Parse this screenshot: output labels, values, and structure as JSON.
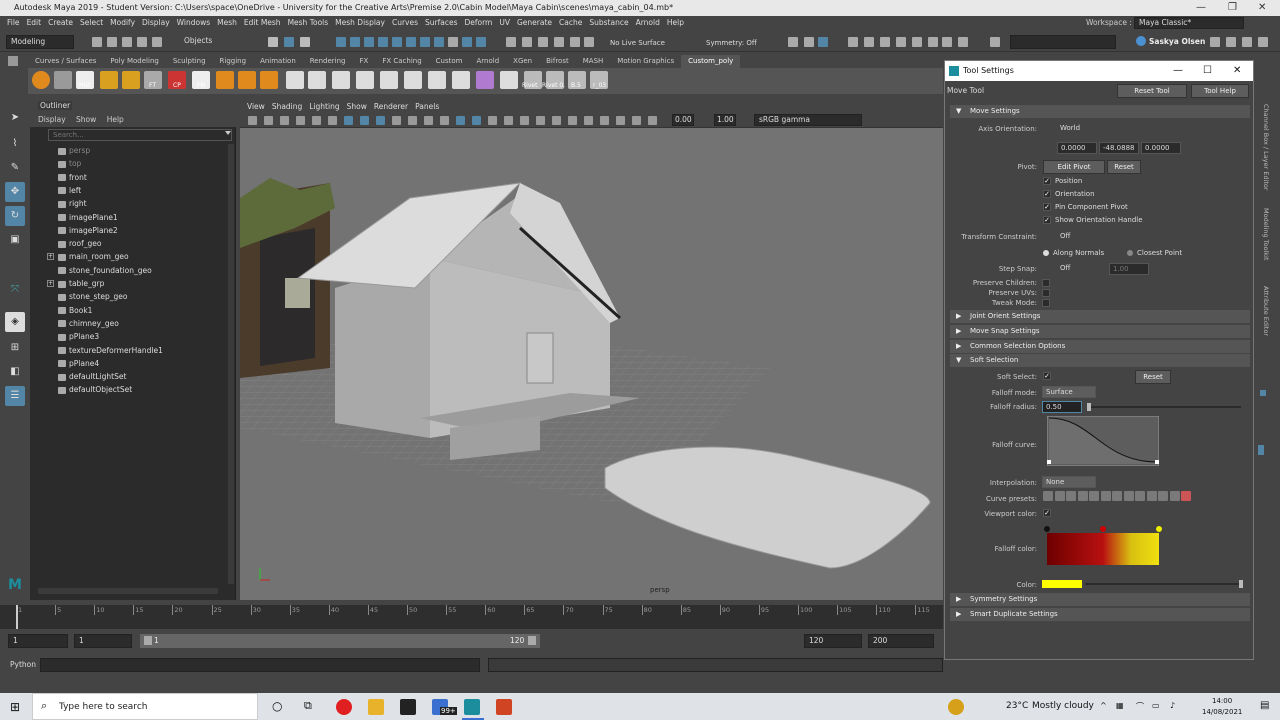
{
  "window": {
    "title": "Autodesk Maya 2019 - Student Version: C:\\Users\\space\\OneDrive - University for the Creative Arts\\Premise 2.0\\Cabin Model\\Maya Cabin\\scenes\\maya_cabin_04.mb*"
  },
  "menubar": [
    "File",
    "Edit",
    "Create",
    "Select",
    "Modify",
    "Display",
    "Windows",
    "Mesh",
    "Edit Mesh",
    "Mesh Tools",
    "Mesh Display",
    "Curves",
    "Surfaces",
    "Deform",
    "UV",
    "Generate",
    "Cache",
    "Substance",
    "Arnold",
    "Help"
  ],
  "workspace": {
    "label": "Workspace :",
    "value": "Maya Classic*"
  },
  "statusline": {
    "mode": "Modeling",
    "objects": "Objects",
    "live_surface": "No Live Surface",
    "symmetry": "Symmetry: Off",
    "user": "Saskya Olsen"
  },
  "shelf": {
    "tabs": [
      "Curves / Surfaces",
      "Poly Modeling",
      "Sculpting",
      "Rigging",
      "Animation",
      "Rendering",
      "FX",
      "FX Caching",
      "Custom",
      "Arnold",
      "XGen",
      "Bifrost",
      "MASH",
      "Motion Graphics",
      "Custom_poly"
    ],
    "active_tab": "Custom_poly",
    "labels": [
      "Hist",
      "FT",
      "CP",
      "FN",
      "Rivet",
      "Rivet 0.",
      "B.5",
      "r_03"
    ]
  },
  "outliner": {
    "title": "Outliner",
    "menu": [
      "Display",
      "Show",
      "Help"
    ],
    "search_placeholder": "Search...",
    "items": [
      {
        "name": "persp",
        "grey": true
      },
      {
        "name": "top",
        "grey": true
      },
      {
        "name": "front",
        "grey": false
      },
      {
        "name": "left",
        "grey": false
      },
      {
        "name": "right",
        "grey": false
      },
      {
        "name": "imagePlane1",
        "grey": false
      },
      {
        "name": "imagePlane2",
        "grey": false
      },
      {
        "name": "roof_geo",
        "grey": false
      },
      {
        "name": "main_room_geo",
        "grey": false
      },
      {
        "name": "stone_foundation_geo",
        "grey": false
      },
      {
        "name": "table_grp",
        "grey": false
      },
      {
        "name": "stone_step_geo",
        "grey": false
      },
      {
        "name": "Book1",
        "grey": false
      },
      {
        "name": "chimney_geo",
        "grey": false
      },
      {
        "name": "pPlane3",
        "grey": false
      },
      {
        "name": "textureDeformerHandle1",
        "grey": false
      },
      {
        "name": "pPlane4",
        "grey": false
      },
      {
        "name": "defaultLightSet",
        "grey": false
      },
      {
        "name": "defaultObjectSet",
        "grey": false
      }
    ]
  },
  "viewport": {
    "menu": [
      "View",
      "Shading",
      "Lighting",
      "Show",
      "Renderer",
      "Panels"
    ],
    "exposure": "0.00",
    "gamma": "1.00",
    "color_space": "sRGB gamma",
    "camera_label": "persp"
  },
  "timeline": {
    "ticks": [
      "1",
      "5",
      "10",
      "15",
      "20",
      "25",
      "30",
      "35",
      "40",
      "45",
      "50",
      "55",
      "60",
      "65",
      "70",
      "75",
      "80",
      "85",
      "90",
      "95",
      "100",
      "105",
      "110",
      "115",
      "120"
    ],
    "range_start": "1",
    "playback_start": "1",
    "slider_start": "1",
    "slider_end": "120",
    "playback_end": "120",
    "range_end": "200"
  },
  "cmdline": {
    "label": "Python"
  },
  "tool_settings": {
    "window_title": "Tool Settings",
    "tool_name": "Move Tool",
    "reset_tool": "Reset Tool",
    "tool_help": "Tool Help",
    "move_settings": {
      "header": "Move Settings",
      "axis_orientation_label": "Axis Orientation:",
      "axis_orientation": "World",
      "values": [
        "0.0000",
        "-48.0888",
        "0.0000"
      ],
      "pivot_label": "Pivot:",
      "edit_pivot": "Edit Pivot",
      "reset": "Reset",
      "checks": [
        "Position",
        "Orientation",
        "Pin Component Pivot",
        "Show Orientation Handle"
      ],
      "transform_constraint_label": "Transform Constraint:",
      "transform_constraint": "Off",
      "along_normals": "Along Normals",
      "closest_point": "Closest Point",
      "step_snap_label": "Step Snap:",
      "step_snap": "Off",
      "step_value": "1.00",
      "preserve_children": "Preserve Children:",
      "preserve_uvs": "Preserve UVs:",
      "tweak_mode": "Tweak Mode:"
    },
    "sections": [
      "Joint Orient Settings",
      "Move Snap Settings",
      "Common Selection Options"
    ],
    "soft_selection": {
      "header": "Soft Selection",
      "soft_select_label": "Soft Select:",
      "reset": "Reset",
      "falloff_mode_label": "Falloff mode:",
      "falloff_mode": "Surface",
      "falloff_radius_label": "Falloff radius:",
      "falloff_radius": "0.50",
      "falloff_curve_label": "Falloff curve:",
      "interpolation_label": "Interpolation:",
      "interpolation": "None",
      "curve_presets_label": "Curve presets:",
      "viewport_color_label": "Viewport color:",
      "falloff_color_label": "Falloff color:",
      "color_label": "Color:"
    },
    "bottom_sections": [
      "Symmetry Settings",
      "Smart Duplicate Settings"
    ]
  },
  "side_tabs": [
    "Channel Box / Layer Editor",
    "Modeling Toolkit",
    "Attribute Editor"
  ],
  "taskbar": {
    "search_placeholder": "Type here to search",
    "weather_temp": "23°C",
    "weather_text": "Mostly cloudy",
    "time": "14:00",
    "date": "14/08/2021",
    "badge": "99+"
  },
  "colors": {
    "accent": "#5285a6",
    "falloff_start": "#8b0000",
    "falloff_end": "#f0e010",
    "viewport_color": "#ffff00"
  }
}
